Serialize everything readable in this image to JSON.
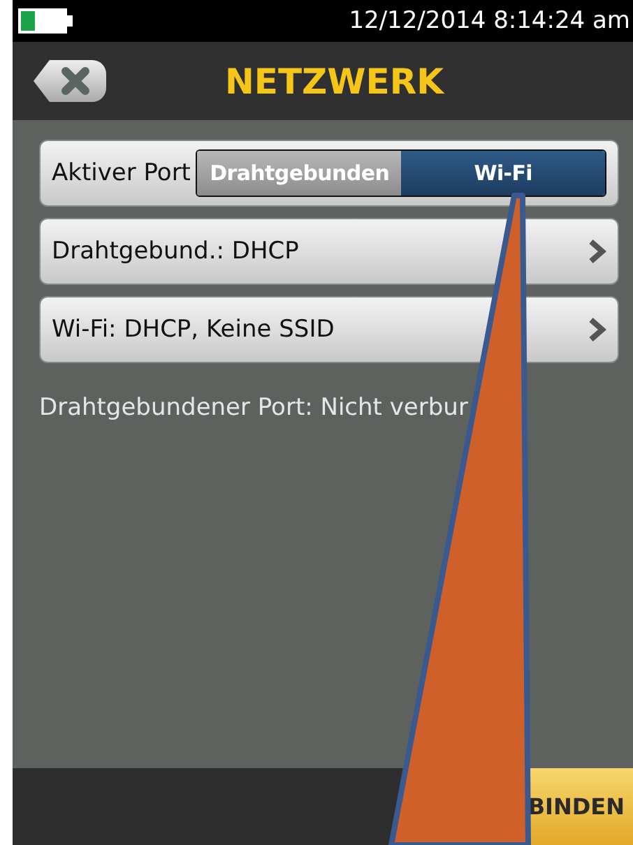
{
  "status_bar": {
    "datetime": "12/12/2014 8:14:24 am"
  },
  "header": {
    "title": "NETZWERK"
  },
  "rows": [
    {
      "kind": "toggle",
      "label": "Aktiver Port",
      "options": [
        {
          "label": "Drahtgebunden",
          "selected": false
        },
        {
          "label": "Wi-Fi",
          "selected": true
        }
      ]
    },
    {
      "kind": "link",
      "label": "Drahtgebund.: DHCP"
    },
    {
      "kind": "link",
      "label": "Wi-Fi: DHCP, Keine SSID"
    }
  ],
  "info": "Drahtgebundener Port: Nicht verbur",
  "footer": {
    "button": "BINDEN"
  }
}
